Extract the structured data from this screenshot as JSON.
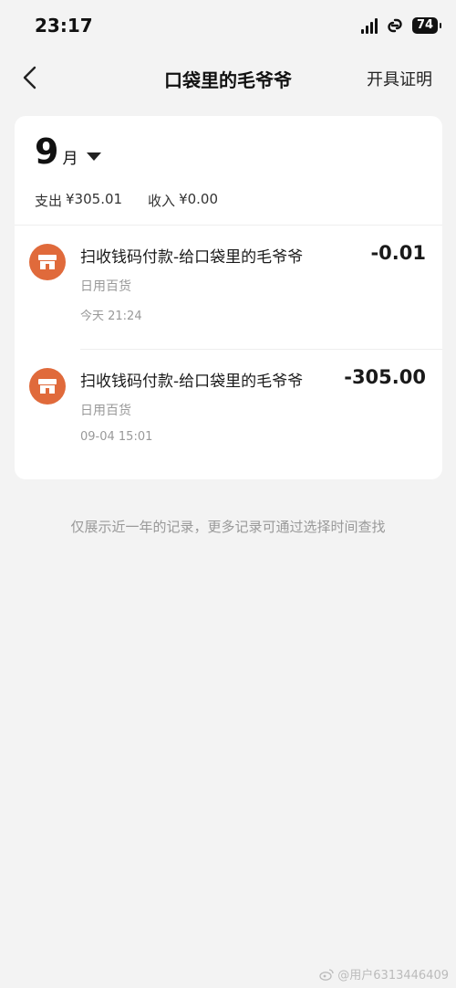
{
  "status_bar": {
    "time": "23:17",
    "battery": "74"
  },
  "nav": {
    "back_icon": "chevron-left-icon",
    "title": "口袋里的毛爷爷",
    "action_label": "开具证明"
  },
  "summary_card": {
    "month_number": "9",
    "month_unit": "月",
    "expense_label": "支出",
    "expense_value": "¥305.01",
    "income_label": "收入",
    "income_value": "¥0.00"
  },
  "transactions": [
    {
      "icon": "shop-icon",
      "title": "扫收钱码付款-给口袋里的毛爷爷",
      "category": "日用百货",
      "time": "今天 21:24",
      "amount": "-0.01"
    },
    {
      "icon": "shop-icon",
      "title": "扫收钱码付款-给口袋里的毛爷爷",
      "category": "日用百货",
      "time": "09-04 15:01",
      "amount": "-305.00"
    }
  ],
  "footer_note": "仅展示近一年的记录，更多记录可通过选择时间查找",
  "watermark": "@用户6313446409",
  "colors": {
    "background": "#f3f3f3",
    "card": "#ffffff",
    "merchant_icon": "#e06a3b",
    "muted_text": "#999999"
  }
}
